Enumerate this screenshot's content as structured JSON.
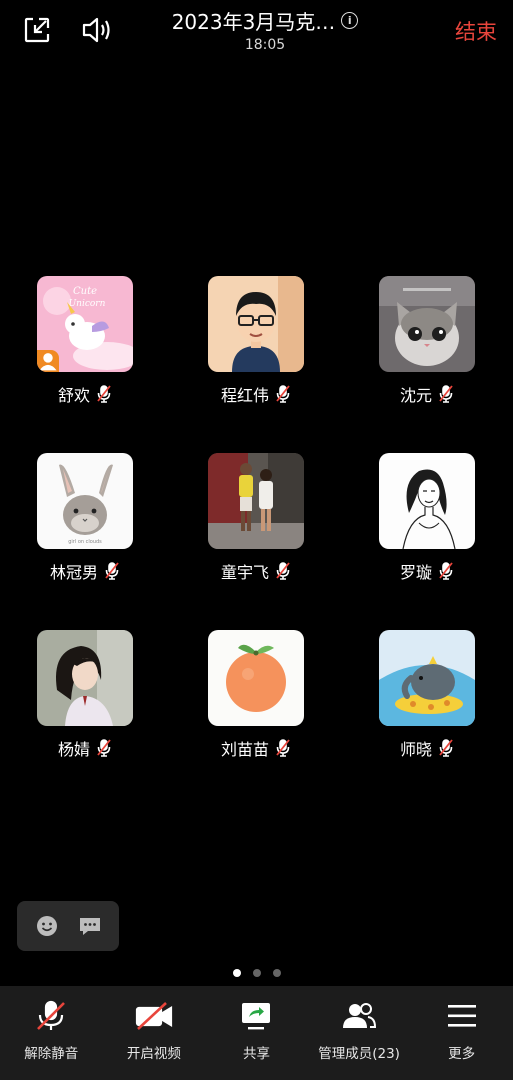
{
  "header": {
    "minimize_icon": "minimize-window-icon",
    "speaker_icon": "speaker-icon",
    "title": "2023年3月马克…",
    "time": "18:05",
    "end_label": "结束",
    "end_color": "#e8453c"
  },
  "participants": [
    {
      "name": "舒欢",
      "avatar": "unicorn",
      "host": true,
      "muted": true
    },
    {
      "name": "程红伟",
      "avatar": "cartoon-man",
      "host": false,
      "muted": true
    },
    {
      "name": "沈元",
      "avatar": "cat",
      "host": false,
      "muted": true
    },
    {
      "name": "林冠男",
      "avatar": "rabbit",
      "host": false,
      "muted": true
    },
    {
      "name": "童宇飞",
      "avatar": "photo-couple",
      "host": false,
      "muted": true
    },
    {
      "name": "罗璇",
      "avatar": "sketch-woman",
      "host": false,
      "muted": true
    },
    {
      "name": "杨婧",
      "avatar": "photo-girl",
      "host": false,
      "muted": true
    },
    {
      "name": "刘苗苗",
      "avatar": "orange",
      "host": false,
      "muted": true
    },
    {
      "name": "师晓",
      "avatar": "elephant",
      "host": false,
      "muted": true
    }
  ],
  "reactions": {
    "emoji_icon": "emoji-icon",
    "chat_icon": "chat-bubble-icon"
  },
  "pager": {
    "pages": 3,
    "current": 1
  },
  "toolbar": {
    "unmute_label": "解除静音",
    "video_label": "开启视频",
    "share_label": "共享",
    "members_label": "管理成员(23)",
    "more_label": "更多"
  }
}
